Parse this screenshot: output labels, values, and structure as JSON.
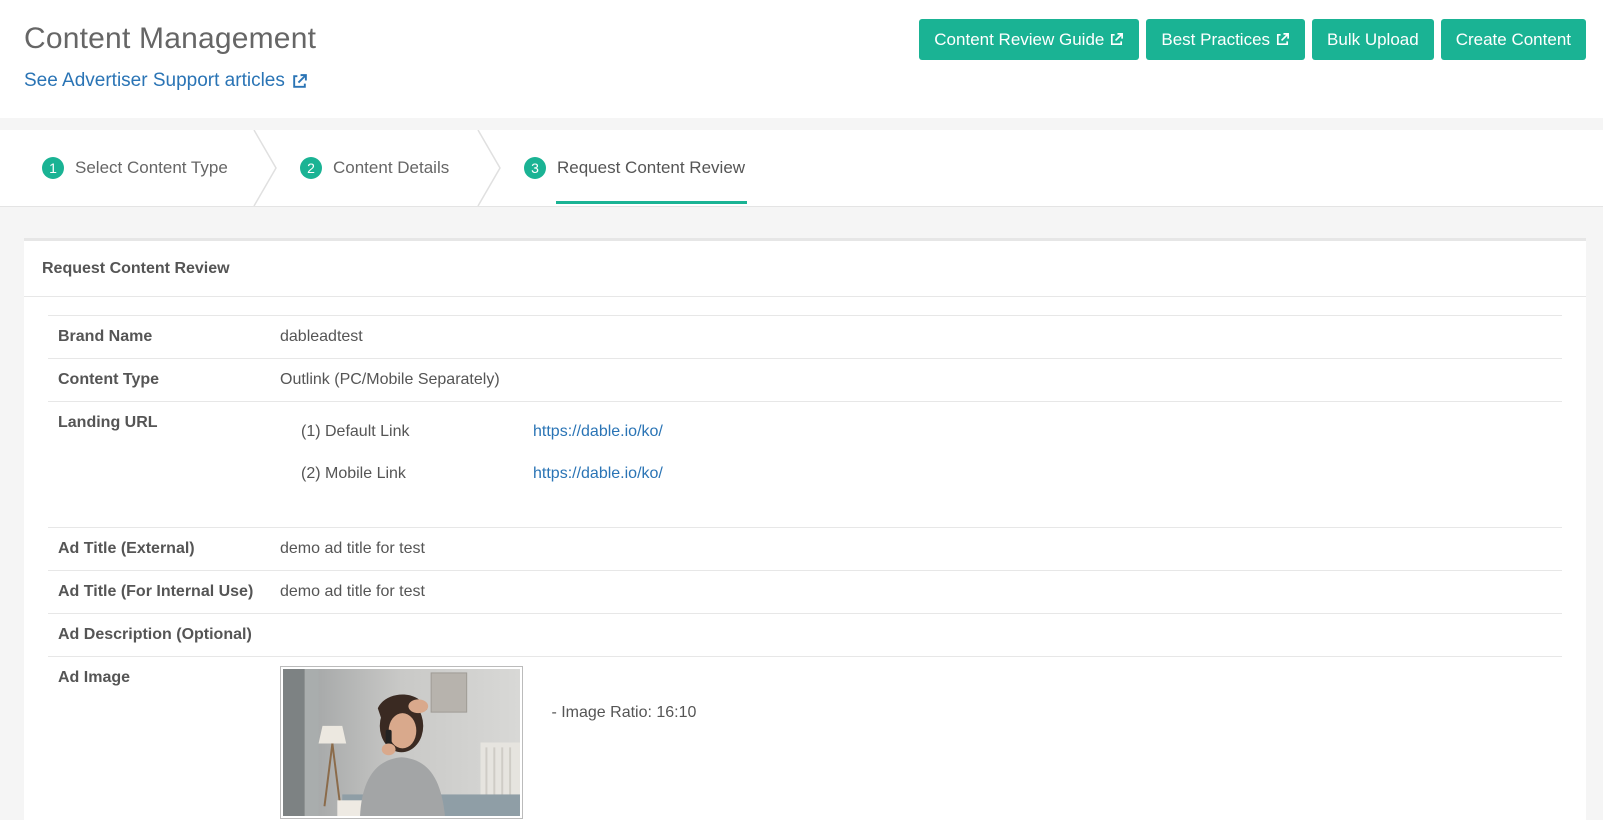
{
  "header": {
    "title": "Content Management",
    "support_link": "See Advertiser Support articles",
    "buttons": {
      "review_guide": "Content Review Guide",
      "best_practices": "Best Practices",
      "bulk_upload": "Bulk Upload",
      "create_content": "Create Content"
    }
  },
  "steps": [
    {
      "num": "1",
      "label": "Select Content Type"
    },
    {
      "num": "2",
      "label": "Content Details"
    },
    {
      "num": "3",
      "label": "Request Content Review"
    }
  ],
  "panel": {
    "title": "Request Content Review",
    "rows": {
      "brand_name": {
        "label": "Brand Name",
        "value": "dableadtest"
      },
      "content_type": {
        "label": "Content Type",
        "value": "Outlink (PC/Mobile Separately)"
      },
      "landing_url": {
        "label": "Landing URL",
        "links": [
          {
            "label": "(1) Default Link",
            "url": "https://dable.io/ko/"
          },
          {
            "label": "(2) Mobile Link",
            "url": "https://dable.io/ko/"
          }
        ]
      },
      "ad_title_external": {
        "label": "Ad Title (External)",
        "value": "demo ad title for test"
      },
      "ad_title_internal": {
        "label": "Ad Title (For Internal Use)",
        "value": "demo ad title for test"
      },
      "ad_description": {
        "label": "Ad Description (Optional)",
        "value": ""
      },
      "ad_image": {
        "label": "Ad Image",
        "ratio": "- Image Ratio: 16:10"
      }
    }
  },
  "colors": {
    "accent": "#1ab394",
    "link": "#2a74b5"
  },
  "icons": [
    "external-link-icon"
  ]
}
